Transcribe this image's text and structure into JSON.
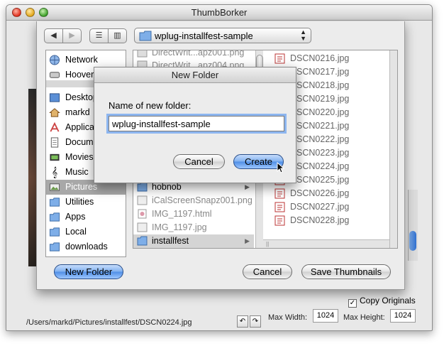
{
  "window": {
    "title": "ThumbBorker"
  },
  "status": {
    "path": "/Users/markd/Pictures/installfest/DSCN0224.jpg"
  },
  "controls": {
    "copy_originals_label": "Copy Originals",
    "copy_originals_checked": true,
    "max_width_label": "Max Width:",
    "max_width_value": "1024",
    "max_height_label": "Max Height:",
    "max_height_value": "1024"
  },
  "sheet": {
    "path_popup": "wplug-installfest-sample",
    "sidebar": [
      {
        "label": "Network",
        "icon": "network-globe-icon"
      },
      {
        "label": "Hoover",
        "icon": "disk-icon"
      },
      {
        "label": "Desktop",
        "icon": "desktop-icon"
      },
      {
        "label": "markd",
        "icon": "home-icon"
      },
      {
        "label": "Applications",
        "icon": "applications-icon"
      },
      {
        "label": "Documents",
        "icon": "documents-icon"
      },
      {
        "label": "Movies",
        "icon": "movies-icon"
      },
      {
        "label": "Music",
        "icon": "music-icon"
      },
      {
        "label": "Pictures",
        "icon": "pictures-icon"
      },
      {
        "label": "Utilities",
        "icon": "folder-icon"
      },
      {
        "label": "Apps",
        "icon": "folder-icon"
      },
      {
        "label": "Local",
        "icon": "folder-icon"
      },
      {
        "label": "downloads",
        "icon": "folder-icon"
      }
    ],
    "column1": [
      {
        "label": "DirectWrit...apz001.png",
        "kind": "file"
      },
      {
        "label": "DirectWrit...apz004.png",
        "kind": "file"
      },
      {
        "label": "hobnob",
        "kind": "folder"
      },
      {
        "label": "iCalScreenSnapz001.png",
        "kind": "file"
      },
      {
        "label": "IMG_1197.html",
        "kind": "file"
      },
      {
        "label": "IMG_1197.jpg",
        "kind": "file"
      },
      {
        "label": "installfest",
        "kind": "folder"
      }
    ],
    "column2": [
      "DSCN0216.jpg",
      "DSCN0217.jpg",
      "DSCN0218.jpg",
      "DSCN0219.jpg",
      "DSCN0220.jpg",
      "DSCN0221.jpg",
      "DSCN0222.jpg",
      "DSCN0223.jpg",
      "DSCN0224.jpg",
      "DSCN0225.jpg",
      "DSCN0226.jpg",
      "DSCN0227.jpg",
      "DSCN0228.jpg"
    ],
    "new_folder_label": "New Folder",
    "cancel_label": "Cancel",
    "save_label": "Save Thumbnails"
  },
  "dialog": {
    "title": "New Folder",
    "prompt": "Name of new folder:",
    "value": "wplug-installfest-sample",
    "cancel_label": "Cancel",
    "create_label": "Create"
  },
  "colors": {
    "accent": "#4f8ee6",
    "selection": "#a8a8a8",
    "focus_ring": "#8db6f0"
  }
}
